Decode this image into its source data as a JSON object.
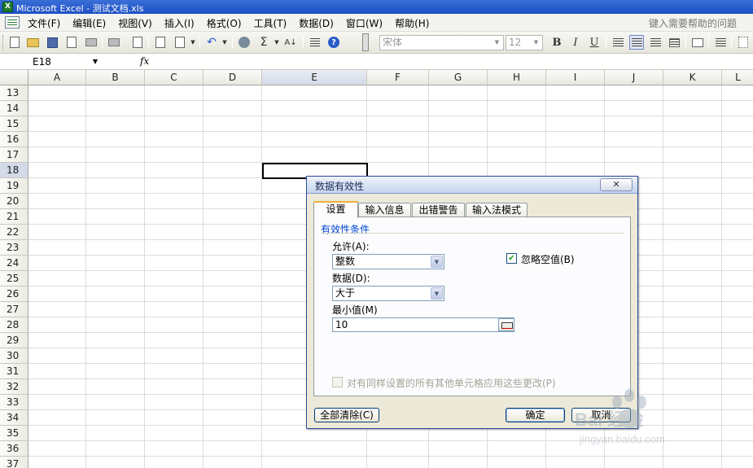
{
  "window": {
    "title": "Microsoft Excel - 测试文档.xls",
    "app_icon_letter": "X"
  },
  "menu": {
    "items": [
      "文件(F)",
      "编辑(E)",
      "视图(V)",
      "插入(I)",
      "格式(O)",
      "工具(T)",
      "数据(D)",
      "窗口(W)",
      "帮助(H)"
    ],
    "help_placeholder": "键入需要帮助的问题"
  },
  "toolbar": {
    "font_name": "宋体",
    "font_size": "12",
    "bold": "B",
    "italic": "I",
    "underline": "U",
    "sigma": "Σ",
    "help": "?"
  },
  "formula_bar": {
    "name_box": "E18",
    "fx": "fx"
  },
  "sheet": {
    "columns": [
      "A",
      "B",
      "C",
      "D",
      "E",
      "F",
      "G",
      "H",
      "I",
      "J",
      "K",
      "L"
    ],
    "rows": [
      "13",
      "14",
      "15",
      "16",
      "17",
      "18",
      "19",
      "20",
      "21",
      "22",
      "23",
      "24",
      "25",
      "26",
      "27",
      "28",
      "29",
      "30",
      "31",
      "32",
      "33",
      "34",
      "35",
      "36",
      "37"
    ],
    "active_cell": "E18",
    "active_column": "E",
    "active_row": "18"
  },
  "dialog": {
    "title": "数据有效性",
    "close": "✕",
    "tabs": [
      "设置",
      "输入信息",
      "出错警告",
      "输入法模式"
    ],
    "active_tab": "设置",
    "group_title": "有效性条件",
    "allow_label": "允许(A):",
    "allow_value": "整数",
    "ignore_blank_label": "忽略空值(B)",
    "ignore_blank_checked": true,
    "data_label": "数据(D):",
    "data_value": "大于",
    "min_label": "最小值(M)",
    "min_value": "10",
    "apply_all_label": "对有同样设置的所有其他单元格应用这些更改(P)",
    "apply_all_checked": false,
    "clear_all": "全部清除(C)",
    "ok": "确定",
    "cancel": "取消"
  },
  "watermark": {
    "brand": "Bai 经验",
    "url": "jingyan.baidu.com"
  }
}
